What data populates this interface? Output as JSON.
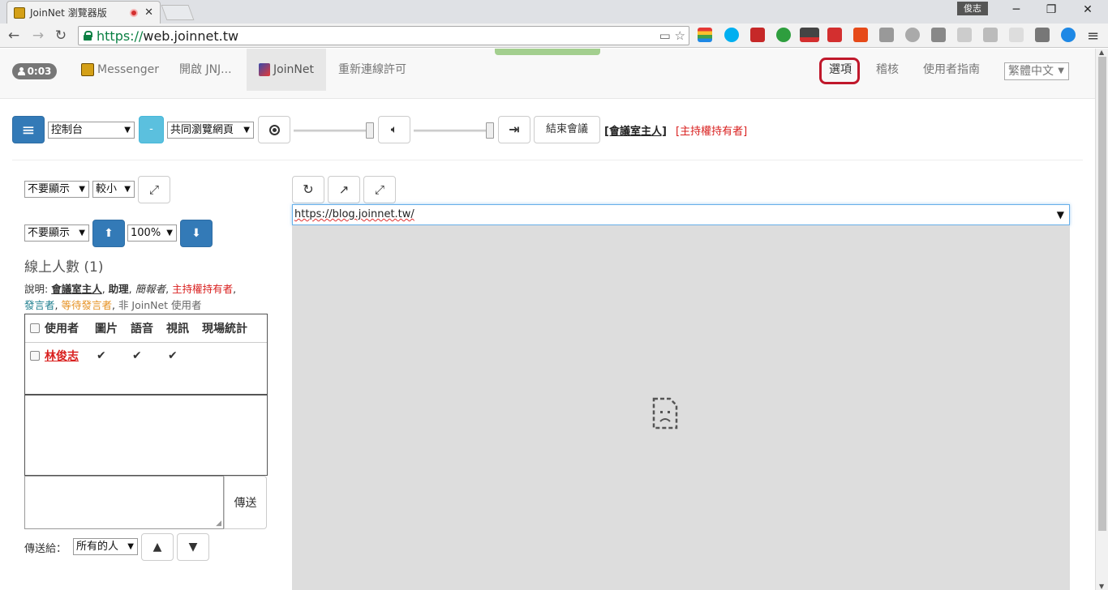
{
  "browser": {
    "tab_title": "JoinNet 瀏覽器版",
    "tab_close": "✕",
    "user_name": "俊志",
    "window_controls": [
      "minimize-icon",
      "restore-icon",
      "close-icon"
    ],
    "url_scheme": "https://",
    "url_host": "web.joinnet.tw"
  },
  "navbar": {
    "timer": "0:03",
    "items": [
      {
        "label": "Messenger",
        "icon": "messenger-icon"
      },
      {
        "label": "開啟 JNJ...",
        "icon": ""
      },
      {
        "label": "JoinNet",
        "icon": "joinnet-icon"
      },
      {
        "label": "重新連線許可",
        "icon": ""
      }
    ],
    "options": "選項",
    "audit": "稽核",
    "guide": "使用者指南",
    "language": "繁體中文"
  },
  "controls": {
    "panel_select": "控制台",
    "minus_label": "-",
    "mode_select": "共同瀏覽網頁",
    "end_meeting": "結束會議",
    "role_host": "[會議室主人]",
    "role_holder": "[主持權持有者]"
  },
  "left": {
    "display_select_1": "不要顯示",
    "size_select": "較小",
    "display_select_2": "不要顯示",
    "zoom_select": "100%",
    "online_count": "線上人數 (1)",
    "legend": {
      "prefix": "說明: ",
      "host": "會議室主人",
      "sep1": ", ",
      "assistant": "助理",
      "sep2": ", ",
      "reporter": "簡報者",
      "sep3": ", ",
      "holder": "主持權持有者",
      "sep4": ",",
      "speaker": "發言者",
      "sep5": ", ",
      "waiting": "等待發言者",
      "sep6": ", ",
      "non_user": "非 JoinNet 使用者"
    },
    "table": {
      "headers": [
        "使用者",
        "圖片",
        "語音",
        "視訊",
        "現場統計"
      ],
      "rows": [
        {
          "user": "林俊志",
          "picture": "✔",
          "audio": "✔",
          "video": "✔",
          "stats": ""
        }
      ]
    },
    "send_button": "傳送",
    "send_to_label": "傳送給：",
    "send_to_select": "所有的人"
  },
  "browse": {
    "url": "https://blog.joinnet.tw/"
  },
  "colors": {
    "primary": "#337ab7",
    "info": "#5bc0de",
    "holder_red": "#d9201f",
    "speaker_teal": "#1f7f8f",
    "waiting_orange": "#e69224",
    "highlight": "#c0182b"
  }
}
